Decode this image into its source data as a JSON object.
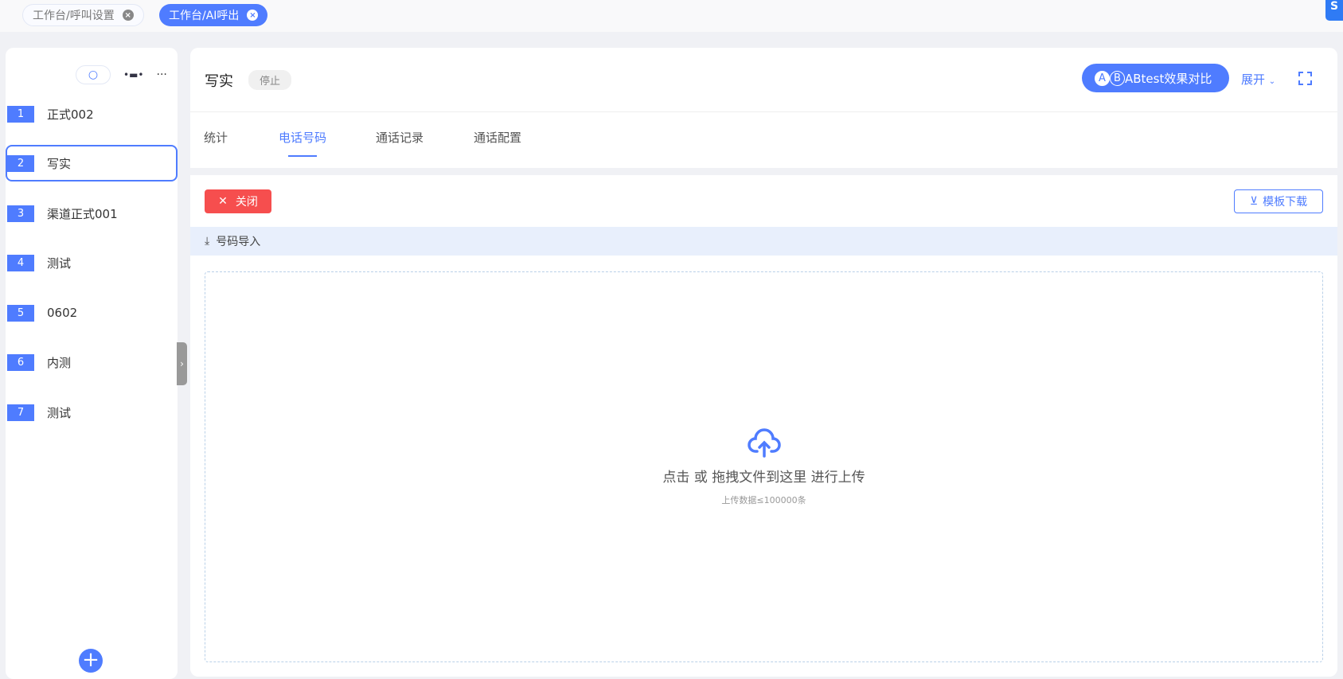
{
  "tabs": [
    {
      "label": "工作台/呼叫设置"
    },
    {
      "label": "工作台/AI呼出"
    }
  ],
  "sidebar": {
    "items": [
      {
        "num": "1",
        "label": "正式002"
      },
      {
        "num": "2",
        "label": "写实"
      },
      {
        "num": "3",
        "label": "渠道正式001"
      },
      {
        "num": "4",
        "label": "测试"
      },
      {
        "num": "5",
        "label": "0602"
      },
      {
        "num": "6",
        "label": "内测"
      },
      {
        "num": "7",
        "label": "测试"
      }
    ],
    "more": "···",
    "add": "+"
  },
  "header": {
    "title": "写实",
    "status": "停止",
    "ab_a": "A",
    "ab_b": "B",
    "ab_label": "ABtest效果对比",
    "expand": "展开"
  },
  "nav": [
    "统计",
    "电话号码",
    "通话记录",
    "通话配置"
  ],
  "toolbar": {
    "close": "关闭",
    "template": "模板下载",
    "import": "号码导入"
  },
  "upload": {
    "main": "点击 或 拖拽文件到这里 进行上传",
    "sub": "上传数据≤100000条"
  },
  "colors": {
    "accent": "#4f7cff",
    "danger": "#f64e4e"
  }
}
